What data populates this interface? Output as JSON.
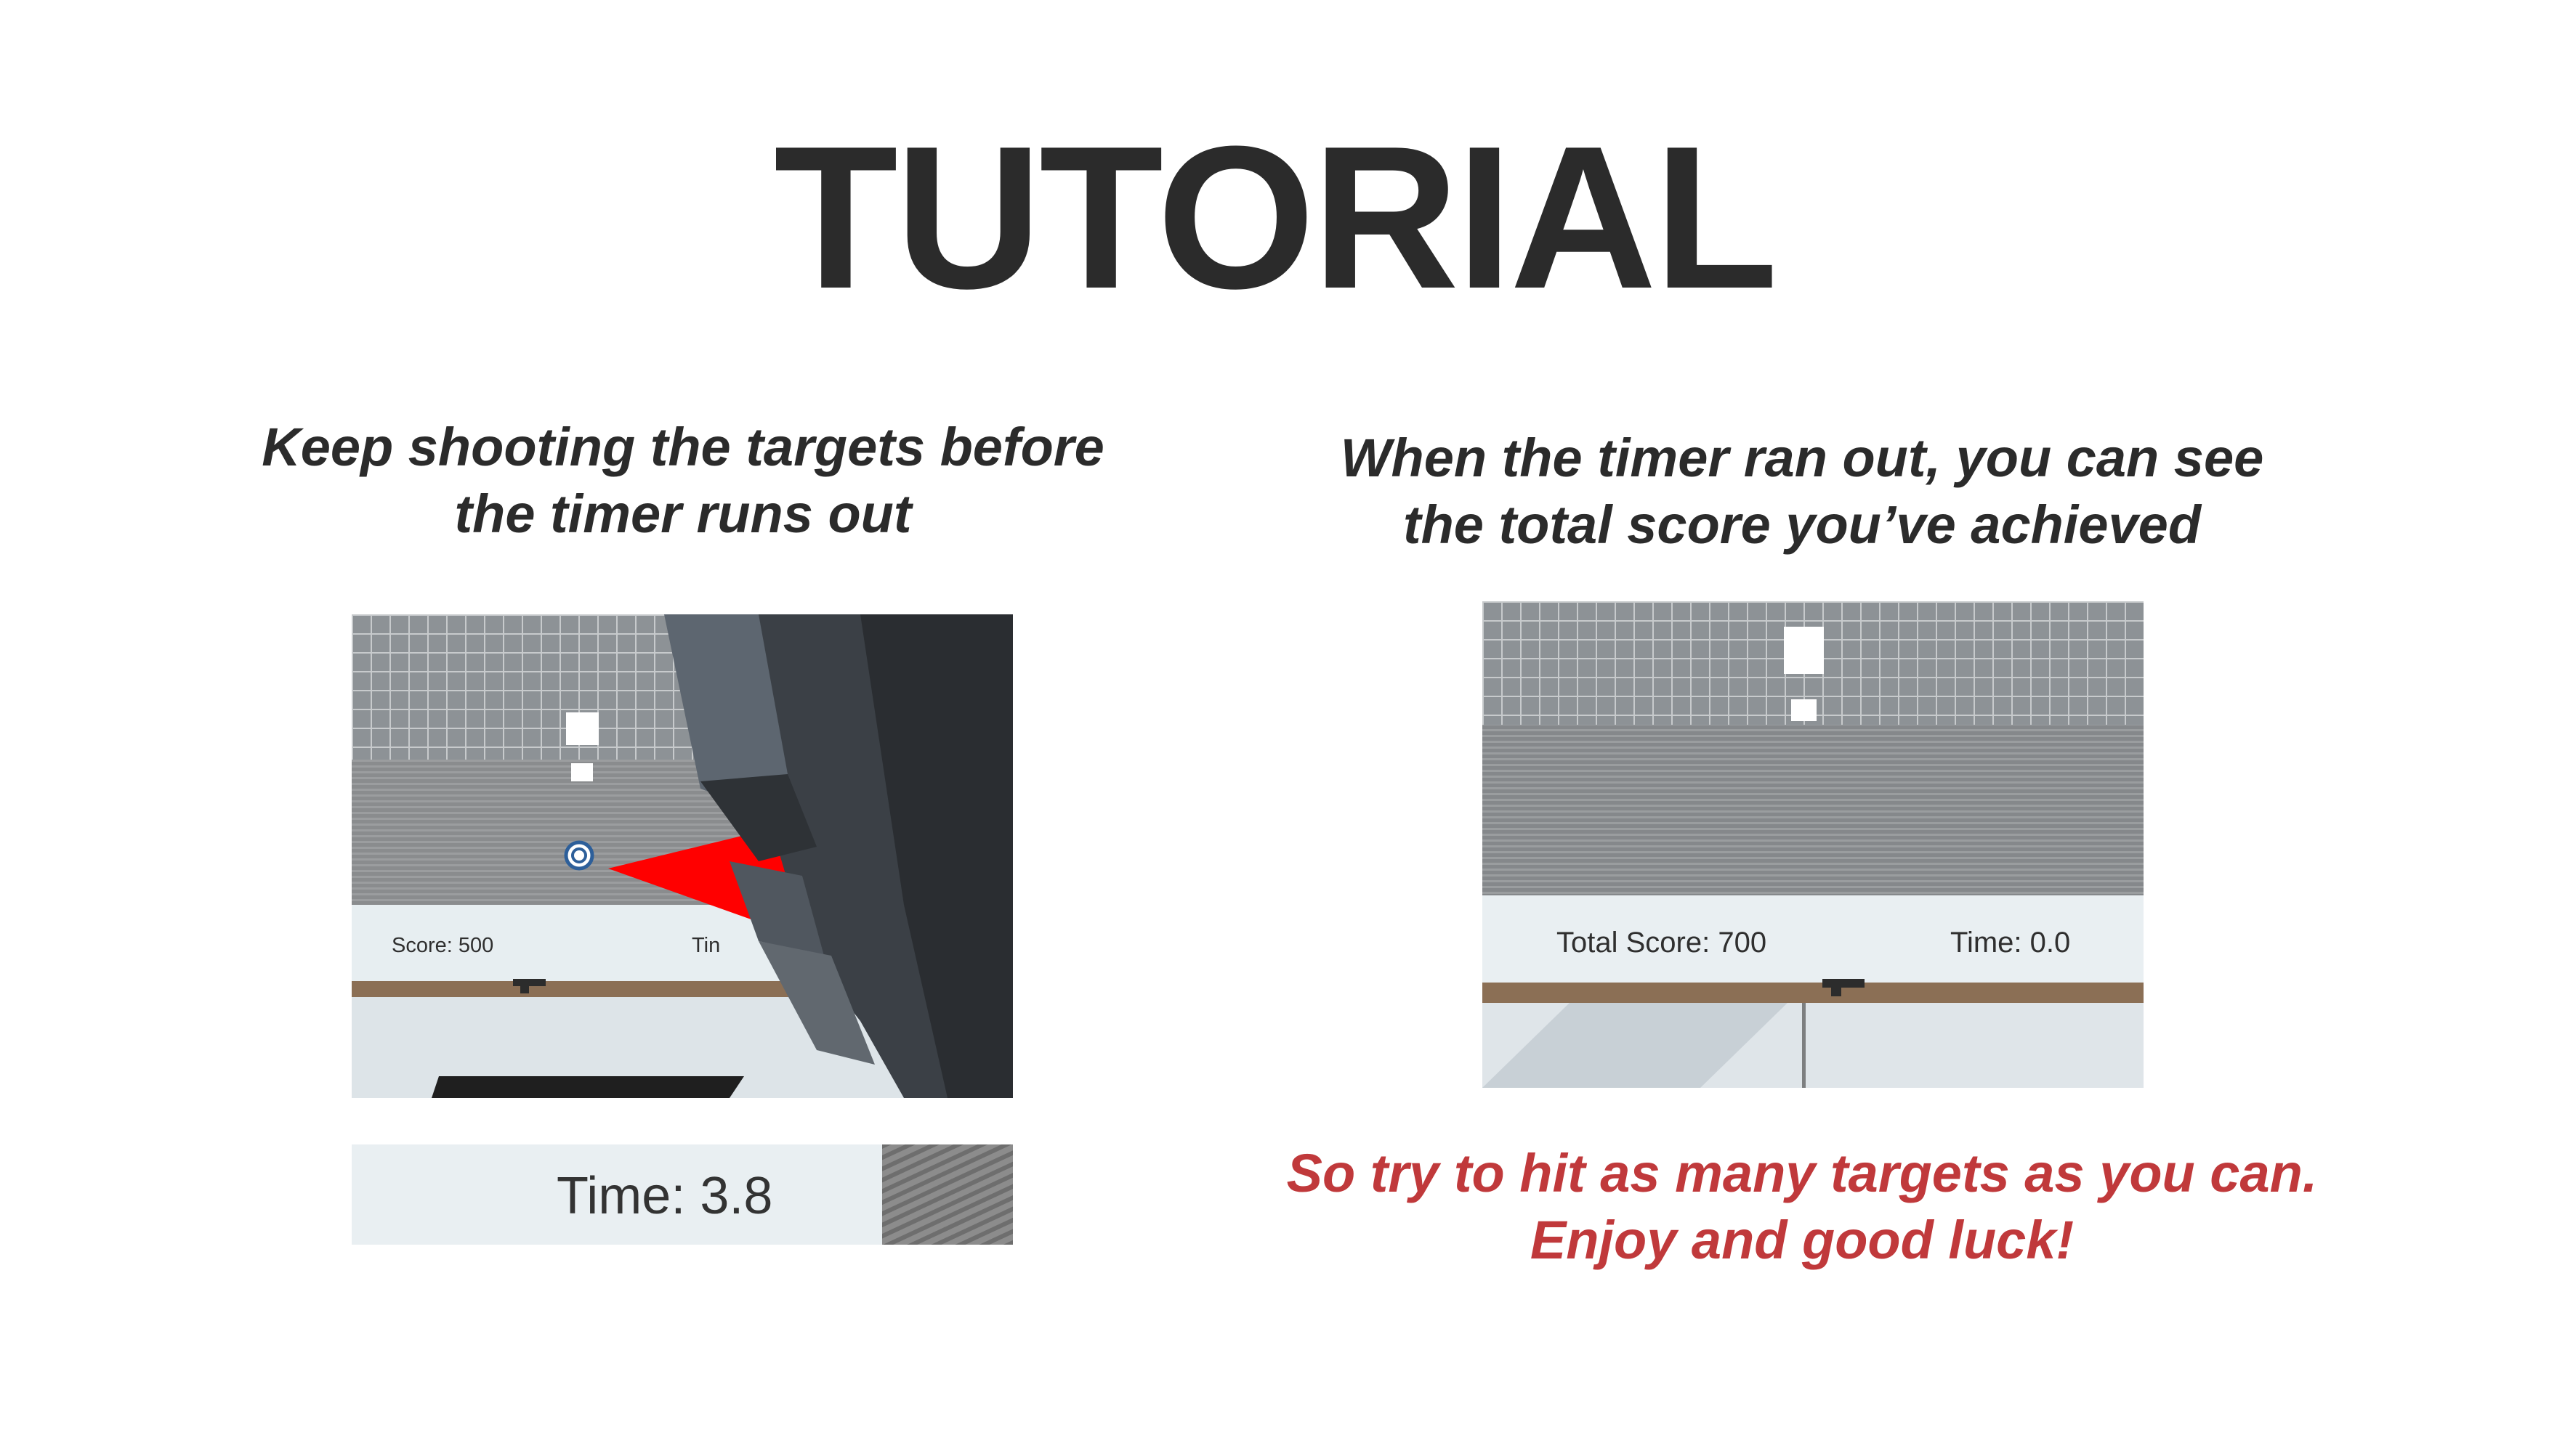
{
  "title": "TUTORIAL",
  "left_caption": {
    "line1": "Keep shooting the targets before",
    "line2": "the timer runs out"
  },
  "right_caption": {
    "line1": "When the timer ran out, you can see",
    "line2": "the total score you’ve achieved"
  },
  "closing_message": {
    "line1": "So try to hit as many targets as you can.",
    "line2": "Enjoy and good luck!",
    "color": "#c0393b"
  },
  "gameplay_screenshot": {
    "score_text": "Score: 500",
    "time_text_partial": "Tin",
    "icons": [
      "bullseye-target-icon",
      "pistol-icon",
      "red-laser-sight"
    ]
  },
  "timer_zoom": {
    "time_text": "Time: 3.8"
  },
  "results_screenshot": {
    "total_score_text": "Total Score: 700",
    "time_text": "Time: 0.0",
    "icons": [
      "pistol-icon"
    ]
  }
}
